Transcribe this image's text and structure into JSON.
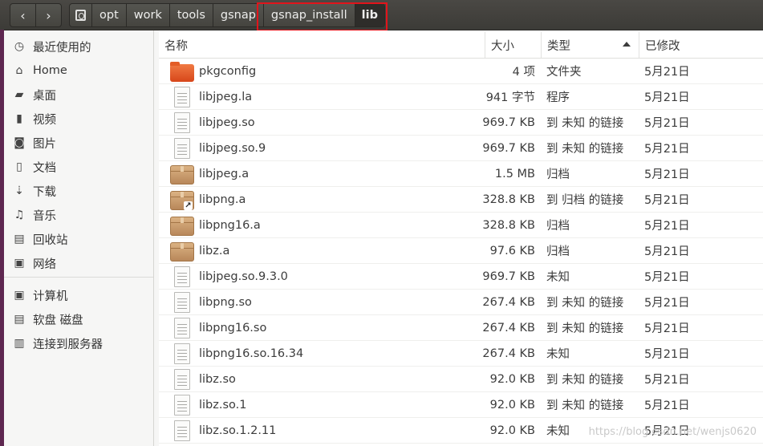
{
  "nav": {
    "back_icon": "chevron-left-icon",
    "forward_icon": "chevron-right-icon",
    "back": "‹",
    "forward": "›"
  },
  "breadcrumb": [
    "opt",
    "work",
    "tools",
    "gsnap",
    "gsnap_install",
    "lib"
  ],
  "sidebar": {
    "items": [
      {
        "label": "最近使用的",
        "icon": "clock-icon",
        "glyph": "◷"
      },
      {
        "label": "Home",
        "icon": "home-icon",
        "glyph": "⌂"
      },
      {
        "label": "桌面",
        "icon": "folder-icon",
        "glyph": "▰"
      },
      {
        "label": "视频",
        "icon": "video-icon",
        "glyph": "▮"
      },
      {
        "label": "图片",
        "icon": "camera-icon",
        "glyph": "◙"
      },
      {
        "label": "文档",
        "icon": "document-icon",
        "glyph": "▯"
      },
      {
        "label": "下载",
        "icon": "download-icon",
        "glyph": "⇣"
      },
      {
        "label": "音乐",
        "icon": "music-icon",
        "glyph": "♫"
      },
      {
        "label": "回收站",
        "icon": "trash-icon",
        "glyph": "▤"
      },
      {
        "label": "网络",
        "icon": "network-icon",
        "glyph": "▣"
      }
    ],
    "devices": [
      {
        "label": "计算机",
        "icon": "computer-icon",
        "glyph": "▣"
      },
      {
        "label": "软盘 磁盘",
        "icon": "disk-icon",
        "glyph": "▤"
      },
      {
        "label": "连接到服务器",
        "icon": "server-icon",
        "glyph": "▥"
      }
    ]
  },
  "columns": {
    "name": "名称",
    "size": "大小",
    "type": "类型",
    "modified": "已修改"
  },
  "files": [
    {
      "name": "pkgconfig",
      "size": "4 项",
      "type": "文件夹",
      "date": "5月21日",
      "icon": "folder"
    },
    {
      "name": "libjpeg.la",
      "size": "941 字节",
      "type": "程序",
      "date": "5月21日",
      "icon": "doc"
    },
    {
      "name": "libjpeg.so",
      "size": "969.7 KB",
      "type": "到 未知 的链接",
      "date": "5月21日",
      "icon": "doc"
    },
    {
      "name": "libjpeg.so.9",
      "size": "969.7 KB",
      "type": "到 未知 的链接",
      "date": "5月21日",
      "icon": "doc"
    },
    {
      "name": "libjpeg.a",
      "size": "1.5 MB",
      "type": "归档",
      "date": "5月21日",
      "icon": "box"
    },
    {
      "name": "libpng.a",
      "size": "328.8 KB",
      "type": "到 归档 的链接",
      "date": "5月21日",
      "icon": "box-link"
    },
    {
      "name": "libpng16.a",
      "size": "328.8 KB",
      "type": "归档",
      "date": "5月21日",
      "icon": "box"
    },
    {
      "name": "libz.a",
      "size": "97.6 KB",
      "type": "归档",
      "date": "5月21日",
      "icon": "box"
    },
    {
      "name": "libjpeg.so.9.3.0",
      "size": "969.7 KB",
      "type": "未知",
      "date": "5月21日",
      "icon": "doc"
    },
    {
      "name": "libpng.so",
      "size": "267.4 KB",
      "type": "到 未知 的链接",
      "date": "5月21日",
      "icon": "doc"
    },
    {
      "name": "libpng16.so",
      "size": "267.4 KB",
      "type": "到 未知 的链接",
      "date": "5月21日",
      "icon": "doc"
    },
    {
      "name": "libpng16.so.16.34",
      "size": "267.4 KB",
      "type": "未知",
      "date": "5月21日",
      "icon": "doc"
    },
    {
      "name": "libz.so",
      "size": "92.0 KB",
      "type": "到 未知 的链接",
      "date": "5月21日",
      "icon": "doc"
    },
    {
      "name": "libz.so.1",
      "size": "92.0 KB",
      "type": "到 未知 的链接",
      "date": "5月21日",
      "icon": "doc"
    },
    {
      "name": "libz.so.1.2.11",
      "size": "92.0 KB",
      "type": "未知",
      "date": "5月21日",
      "icon": "doc"
    }
  ],
  "watermark": "https://blog.csdn.net/wenjs0620",
  "colors": {
    "highlight": "#e2141b",
    "headerbar": "#3c3b37",
    "folder": "#e35d27"
  }
}
